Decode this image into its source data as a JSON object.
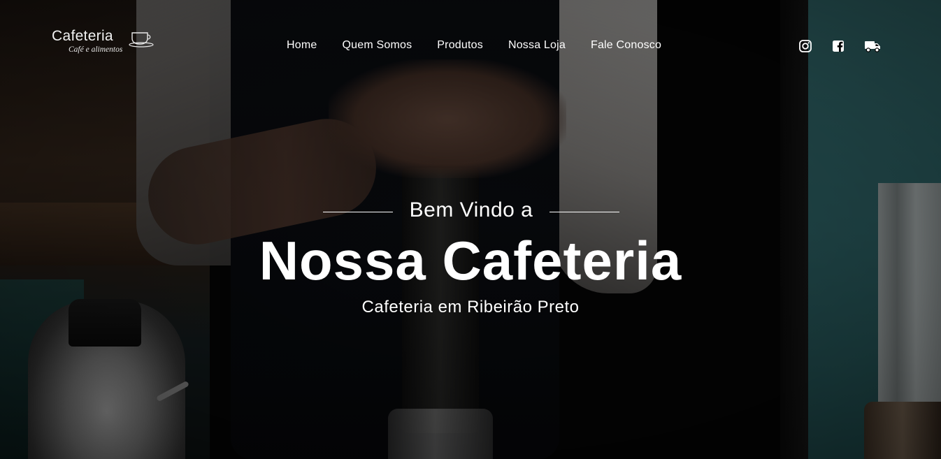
{
  "logo": {
    "name": "Cafeteria",
    "tagline": "Café e alimentos"
  },
  "nav": {
    "items": [
      {
        "label": "Home"
      },
      {
        "label": "Quem Somos"
      },
      {
        "label": "Produtos"
      },
      {
        "label": "Nossa Loja"
      },
      {
        "label": "Fale Conosco"
      }
    ]
  },
  "social": {
    "icons": [
      "instagram-icon",
      "facebook-icon",
      "delivery-truck-icon"
    ]
  },
  "hero": {
    "welcome": "Bem Vindo a",
    "title": "Nossa Cafeteria",
    "subtitle": "Cafeteria em Ribeirão Preto"
  },
  "colors": {
    "text": "#ffffff",
    "background": "#000000",
    "accent_teal": "#3c7f82"
  }
}
